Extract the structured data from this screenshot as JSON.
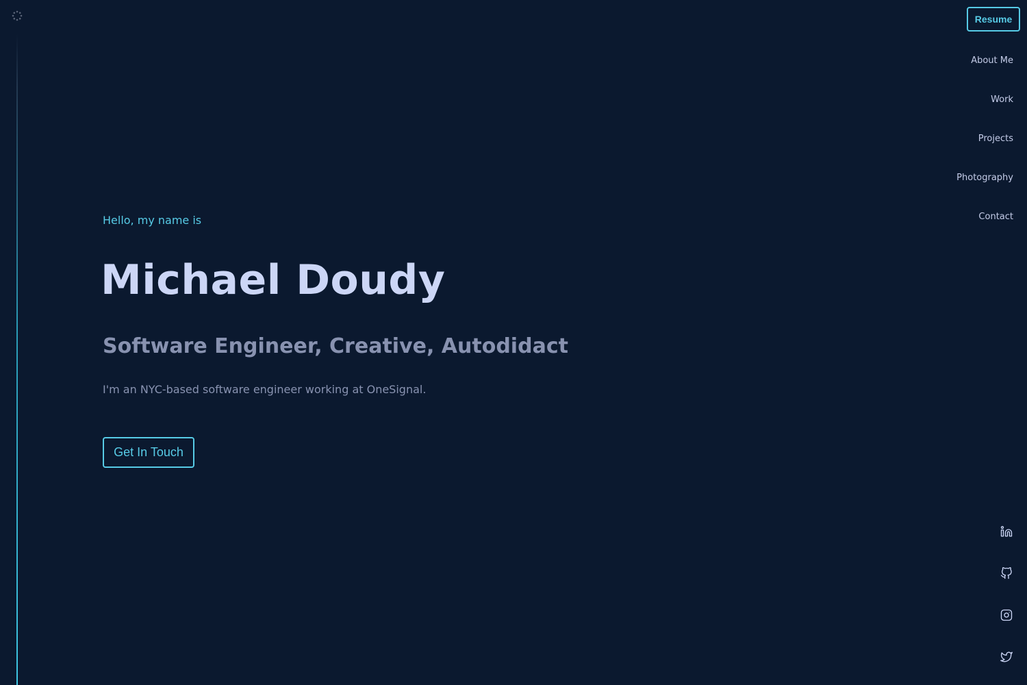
{
  "header": {
    "resume_label": "Resume"
  },
  "nav": {
    "items": [
      {
        "label": "About Me"
      },
      {
        "label": "Work"
      },
      {
        "label": "Projects"
      },
      {
        "label": "Photography"
      },
      {
        "label": "Contact"
      }
    ]
  },
  "hero": {
    "greeting": "Hello, my name is",
    "name": "Michael Doudy",
    "tagline": "Software Engineer, Creative, Autodidact",
    "bio": "I'm an NYC-based software engineer working at OneSignal.",
    "cta_label": "Get In Touch"
  },
  "social": {
    "icons": [
      "linkedin-icon",
      "github-icon",
      "instagram-icon",
      "twitter-icon"
    ]
  },
  "colors": {
    "background": "#0b192f",
    "accent": "#57cbe6",
    "heading": "#ccd6f6",
    "muted": "#8892b0",
    "nav_text": "#c4cce8"
  }
}
